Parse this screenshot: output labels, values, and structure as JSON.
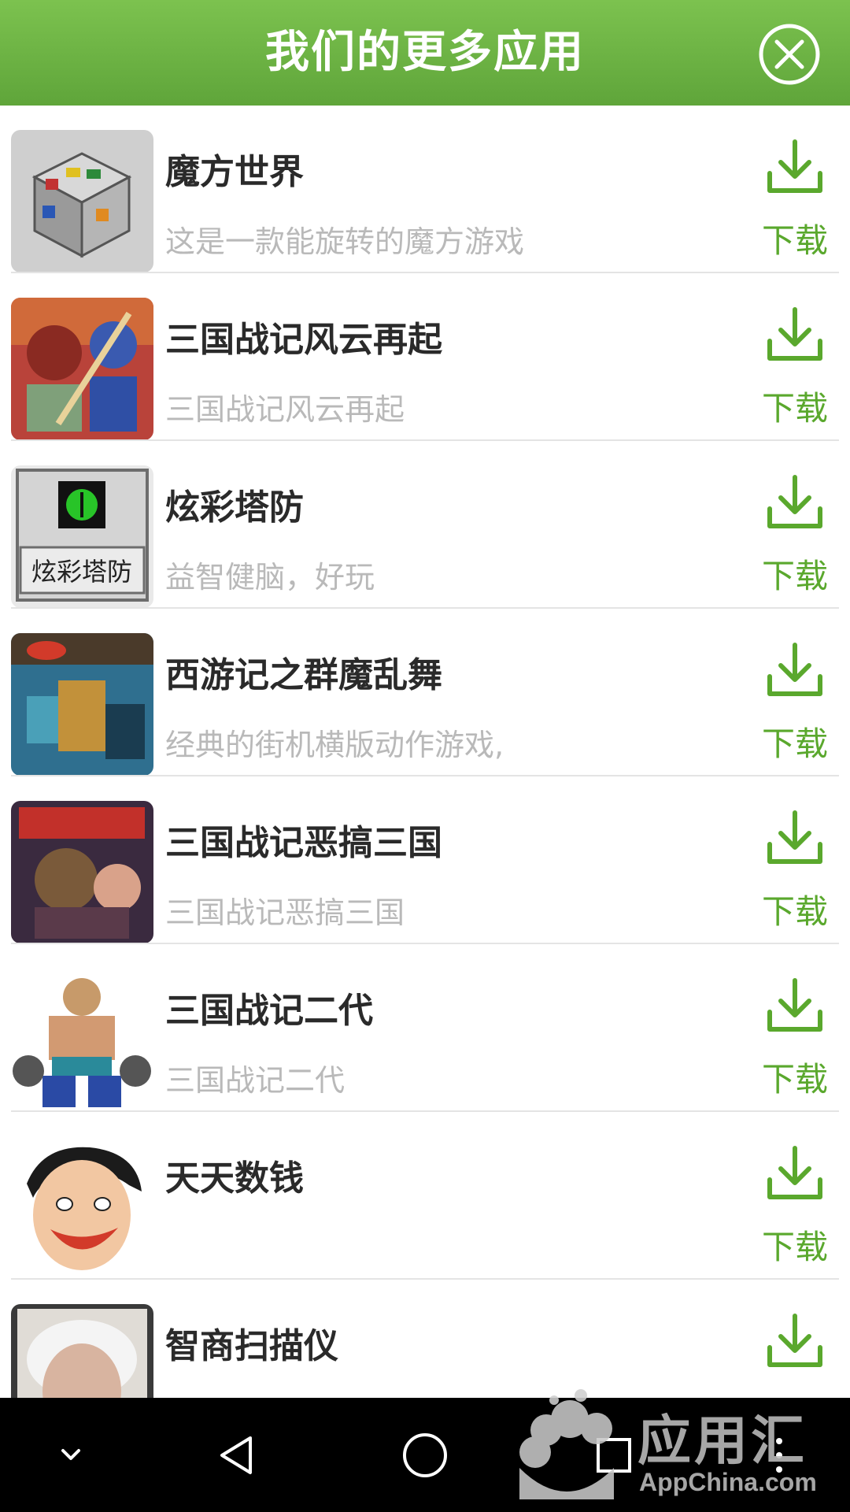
{
  "header": {
    "title": "我们的更多应用",
    "close_icon": "close-circle-icon"
  },
  "apps": [
    {
      "name": "魔方世界",
      "desc": "这是一款能旋转的魔方游戏",
      "download_label": "下载"
    },
    {
      "name": "三国战记风云再起",
      "desc": "三国战记风云再起",
      "download_label": "下载"
    },
    {
      "name": "炫彩塔防",
      "desc": "益智健脑，好玩",
      "download_label": "下载",
      "icon_caption": "炫彩塔防"
    },
    {
      "name": "西游记之群魔乱舞",
      "desc": "经典的街机横版动作游戏,",
      "download_label": "下载"
    },
    {
      "name": "三国战记恶搞三国",
      "desc": "三国战记恶搞三国",
      "download_label": "下载"
    },
    {
      "name": "三国战记二代",
      "desc": "三国战记二代",
      "download_label": "下载"
    },
    {
      "name": "天天数钱",
      "desc": "",
      "download_label": "下载"
    },
    {
      "name": "智商扫描仪",
      "desc": "",
      "download_label": "下载"
    }
  ],
  "nav": {
    "items": [
      "chevron-down-icon",
      "back-icon",
      "home-icon",
      "recents-icon",
      "more-icon"
    ]
  },
  "watermark": {
    "title": "应用汇",
    "subtitle": "AppChina.com"
  },
  "colors": {
    "header": "#6bb343",
    "accent": "#5aa82d",
    "name": "#2a2a2a",
    "desc": "#b9b9b9"
  }
}
